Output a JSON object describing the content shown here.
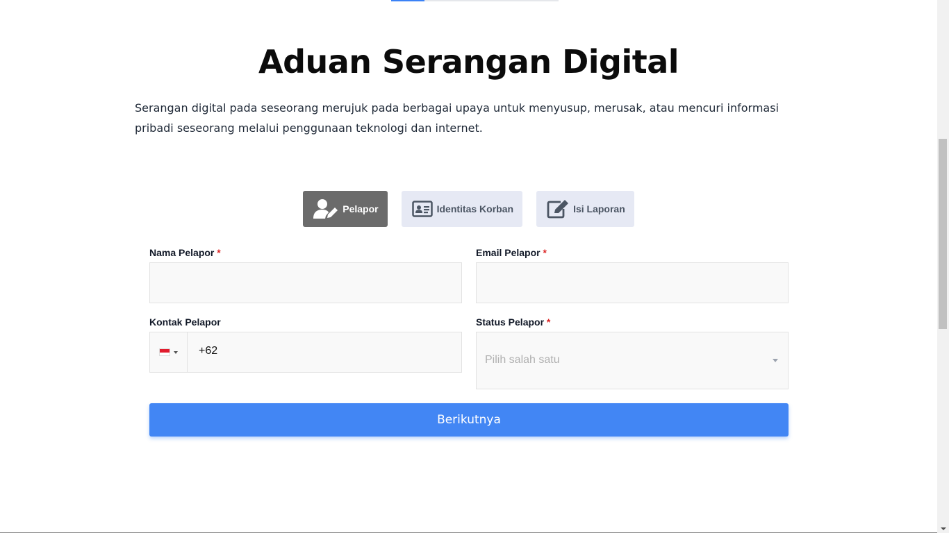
{
  "page": {
    "title": "Aduan Serangan Digital",
    "description": "Serangan digital pada seseorang merujuk pada berbagai upaya untuk menyusup, merusak, atau mencuri informasi pribadi seseorang melalui penggunaan teknologi dan internet."
  },
  "tabs": [
    {
      "label": "Pelapor",
      "icon": "user-edit-icon",
      "active": true
    },
    {
      "label": "Identitas Korban",
      "icon": "id-card-icon",
      "active": false
    },
    {
      "label": "Isi Laporan",
      "icon": "edit-icon",
      "active": false
    }
  ],
  "form": {
    "nama": {
      "label": "Nama Pelapor",
      "required_mark": "*",
      "value": ""
    },
    "email": {
      "label": "Email Pelapor",
      "required_mark": "*",
      "value": ""
    },
    "kontak": {
      "label": "Kontak Pelapor",
      "flag": "indonesia-flag-icon",
      "value": "+62"
    },
    "status": {
      "label": "Status Pelapor",
      "required_mark": "*",
      "placeholder": "Pilih salah satu"
    }
  },
  "submit_label": "Berikutnya",
  "colors": {
    "accent": "#4286f4",
    "tab_active_bg": "#6b6b6b",
    "tab_bg": "#e6e9f4",
    "required": "#dc2626"
  }
}
